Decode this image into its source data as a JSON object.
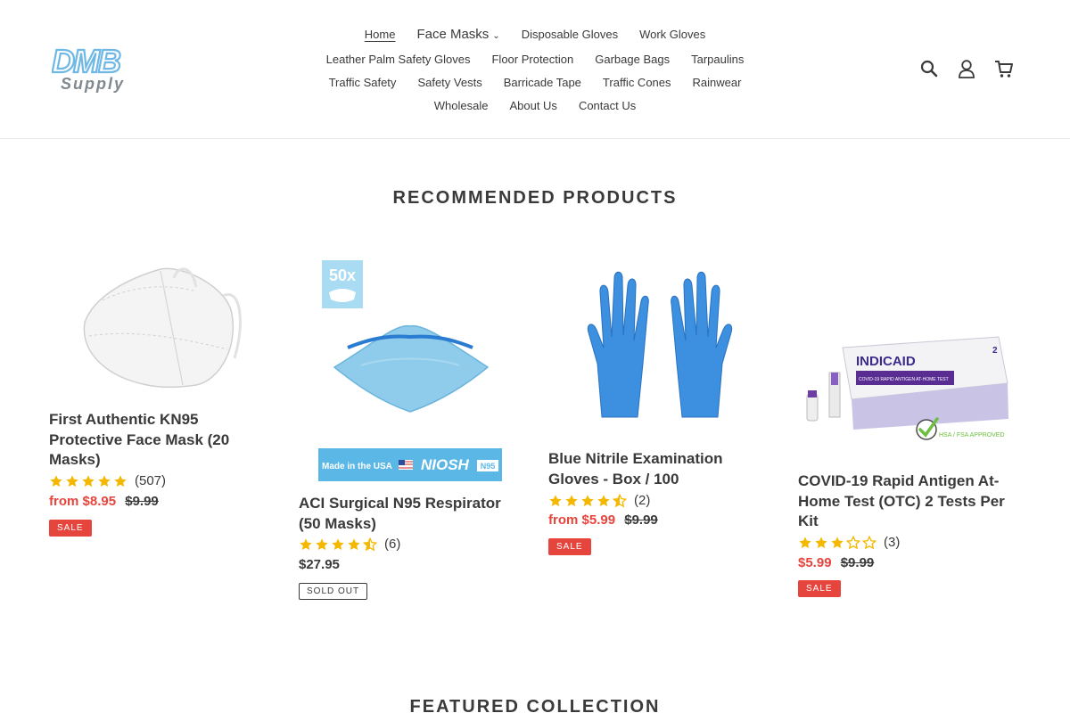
{
  "brand": {
    "logo_line1": "DMB",
    "logo_line2": "Supply",
    "logo_color": "#6fb8e6"
  },
  "nav": {
    "items": [
      {
        "label": "Home",
        "active": true
      },
      {
        "label": "Face Masks"
      },
      {
        "label": "Disposable Gloves"
      },
      {
        "label": "Work Gloves"
      },
      {
        "label": "Leather Palm Safety Gloves"
      },
      {
        "label": "Floor Protection"
      },
      {
        "label": "Garbage Bags"
      },
      {
        "label": "Tarpaulins"
      },
      {
        "label": "Traffic Safety"
      },
      {
        "label": "Safety Vests"
      },
      {
        "label": "Barricade Tape"
      },
      {
        "label": "Traffic Cones"
      },
      {
        "label": "Rainwear"
      },
      {
        "label": "Wholesale"
      },
      {
        "label": "About Us"
      },
      {
        "label": "Contact Us"
      }
    ]
  },
  "header_icons": [
    "search-icon",
    "account-icon",
    "cart-icon"
  ],
  "sections": {
    "recommended": "RECOMMENDED PRODUCTS",
    "featured": "FEATURED COLLECTION"
  },
  "colors": {
    "sale": "#e6453d",
    "star": "#f5b800",
    "text": "#3a3a3a"
  },
  "products": [
    {
      "title": "First Authentic KN95 Protective Face Mask (20 Masks)",
      "rating": 5,
      "review_count": "(507)",
      "price_prefix": "from",
      "price": "$8.95",
      "compare_price": "$9.99",
      "badge": "SALE"
    },
    {
      "title": "ACI Surgical N95 Respirator (50 Masks)",
      "rating": 4.5,
      "review_count": "(6)",
      "price": "$27.95",
      "badge": "SOLD OUT",
      "image_text": {
        "count": "50x",
        "banner": "Made in the USA",
        "brand": "NIOSH",
        "model": "N95"
      }
    },
    {
      "title": "Blue Nitrile Examination Gloves - Box / 100",
      "rating": 4.5,
      "review_count": "(2)",
      "price_prefix": "from",
      "price": "$5.99",
      "compare_price": "$9.99",
      "badge": "SALE"
    },
    {
      "title": "COVID-19 Rapid Antigen At-Home Test (OTC) 2 Tests Per Kit",
      "rating": 3,
      "review_count": "(3)",
      "price": "$5.99",
      "compare_price": "$9.99",
      "badge": "SALE",
      "image_text": {
        "brand": "INDICAID",
        "sub": "COVID-19 RAPID ANTIGEN AT-HOME TEST",
        "approved": "HSA / FSA APPROVED",
        "count": "2"
      }
    }
  ]
}
